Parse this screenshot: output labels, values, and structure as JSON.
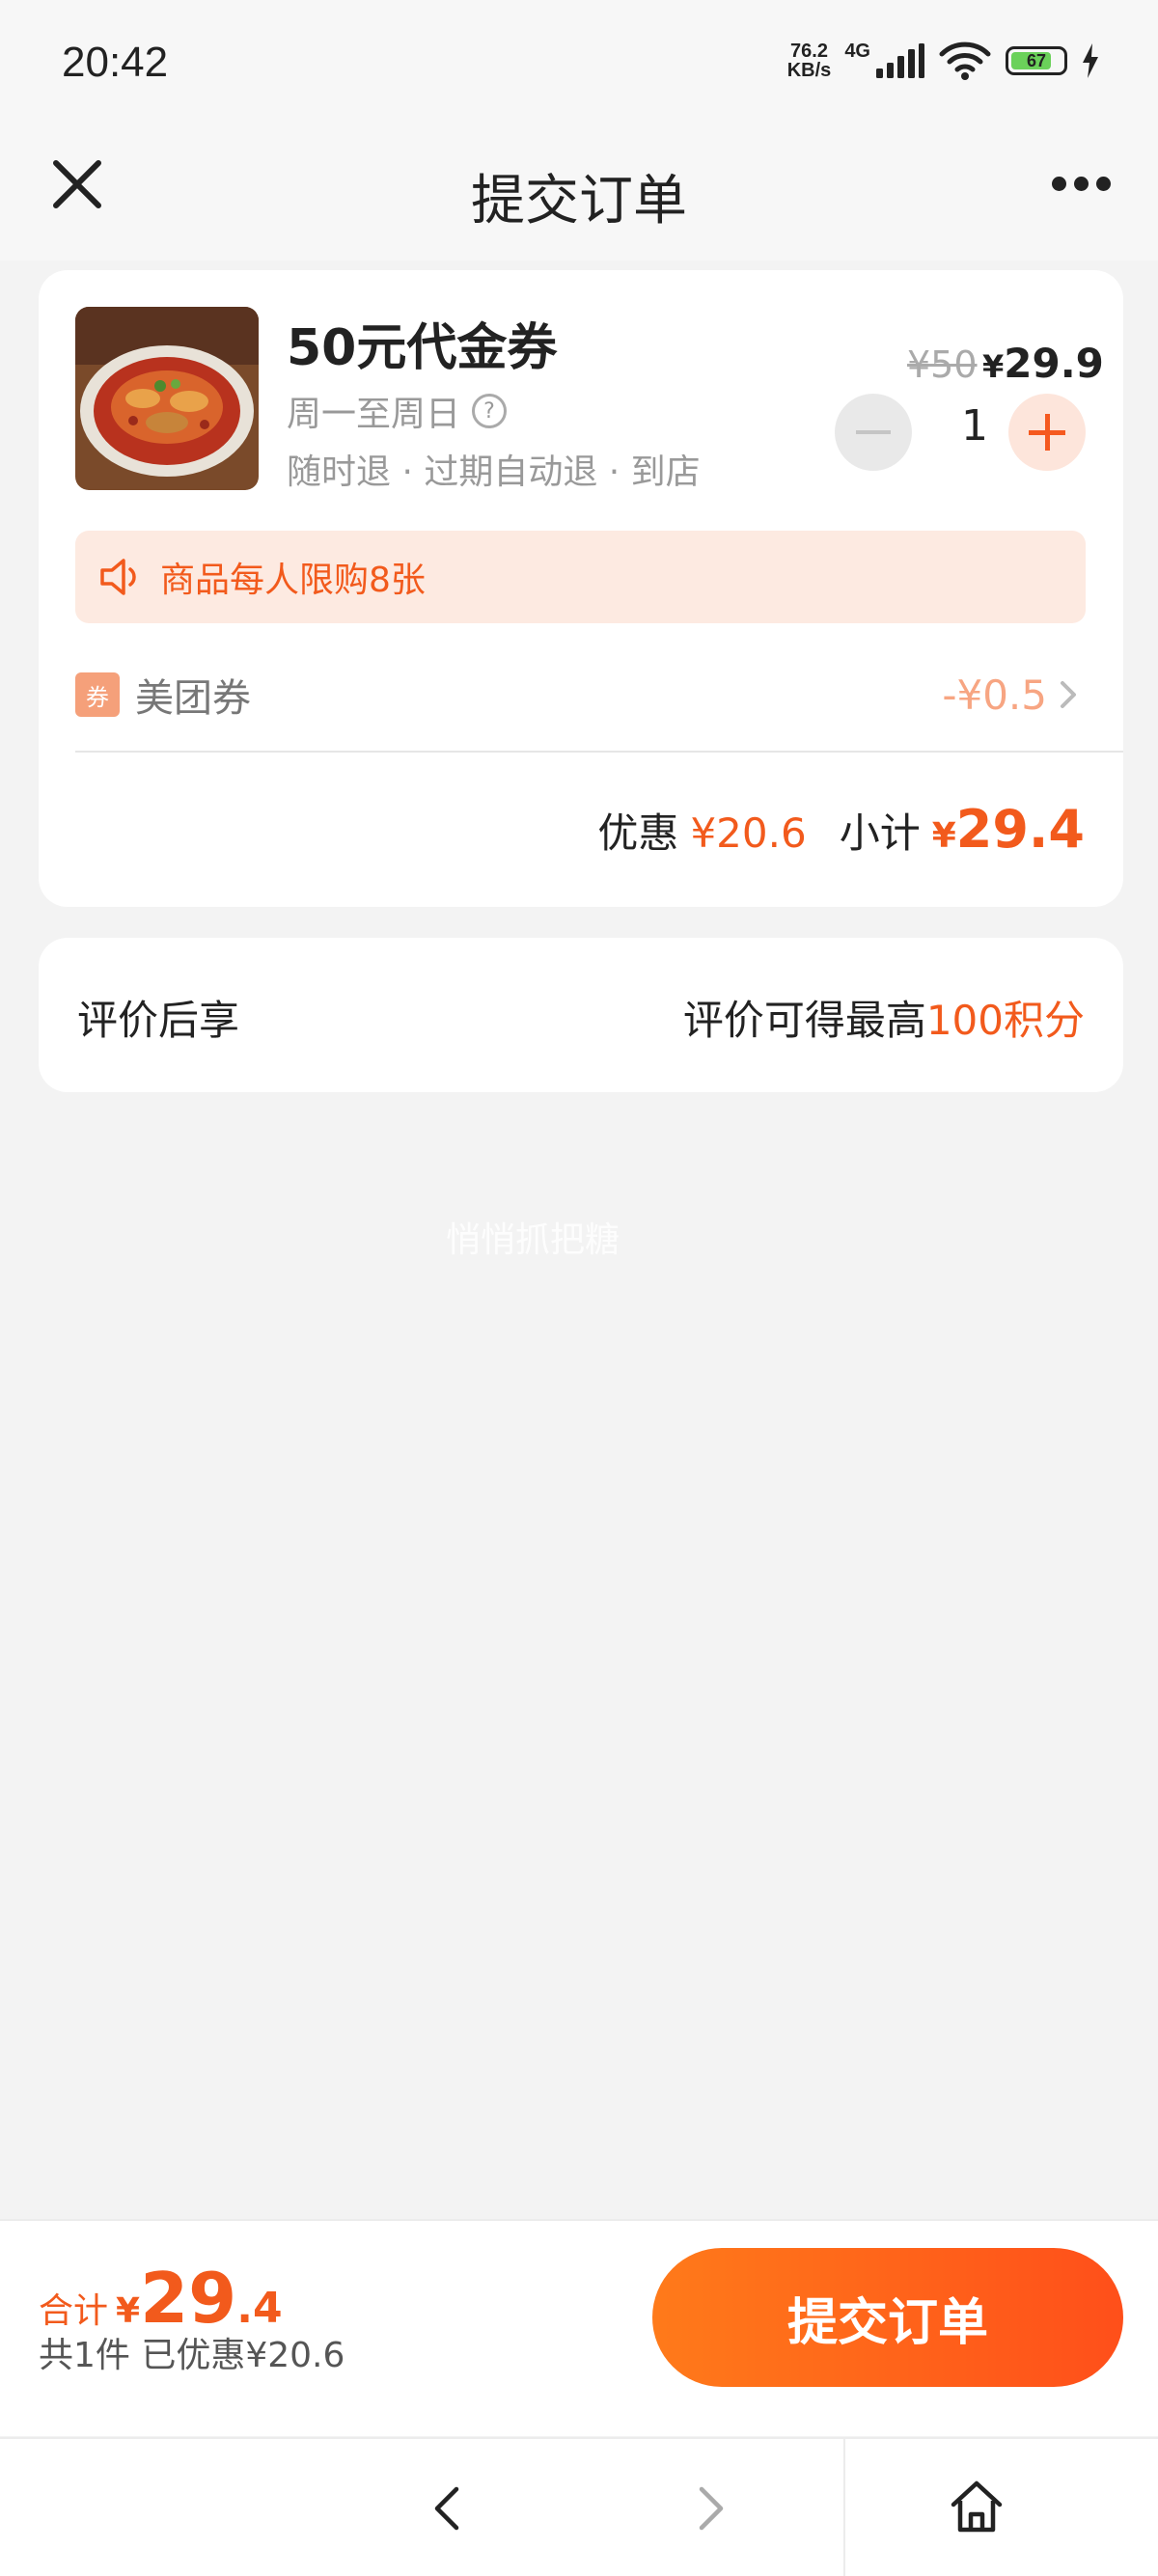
{
  "status_bar": {
    "time": "20:42",
    "net_speed_value": "76.2",
    "net_speed_unit": "KB/s",
    "network": "4G",
    "battery": "67"
  },
  "nav": {
    "title": "提交订单",
    "icons": {
      "close": "close-icon",
      "more": "more-icon"
    }
  },
  "order": {
    "product_title": "50元代金券",
    "valid_days": "周一至周日",
    "tags": "随时退 · 过期自动退 · 到店",
    "price_original": "¥50",
    "price_current_yen": "¥",
    "price_current": "29.9",
    "quantity": "1",
    "limit_notice": "商品每人限购8张",
    "coupon": {
      "tag": "券",
      "label": "美团券",
      "value": "-¥0.5"
    },
    "summary": {
      "discount_label": "优惠",
      "discount_value": "¥20.6",
      "subtotal_label": "小计",
      "subtotal_yen": "¥",
      "subtotal_value": "29.4"
    }
  },
  "review": {
    "left": "评价后享",
    "right_prefix": "评价可得最高",
    "right_highlight": "100积分"
  },
  "watermark": "悄悄抓把糖",
  "footer": {
    "total_label": "合计",
    "total_yen": "¥",
    "total_int": "29",
    "total_dec": ".4",
    "items_info": "共1件  已优惠¥20.6",
    "submit_label": "提交订单"
  },
  "colors": {
    "accent": "#f25a1c",
    "button_gradient_start": "#ff7a1a",
    "button_gradient_end": "#ff4f1a",
    "notice_bg": "#fdeae1"
  }
}
